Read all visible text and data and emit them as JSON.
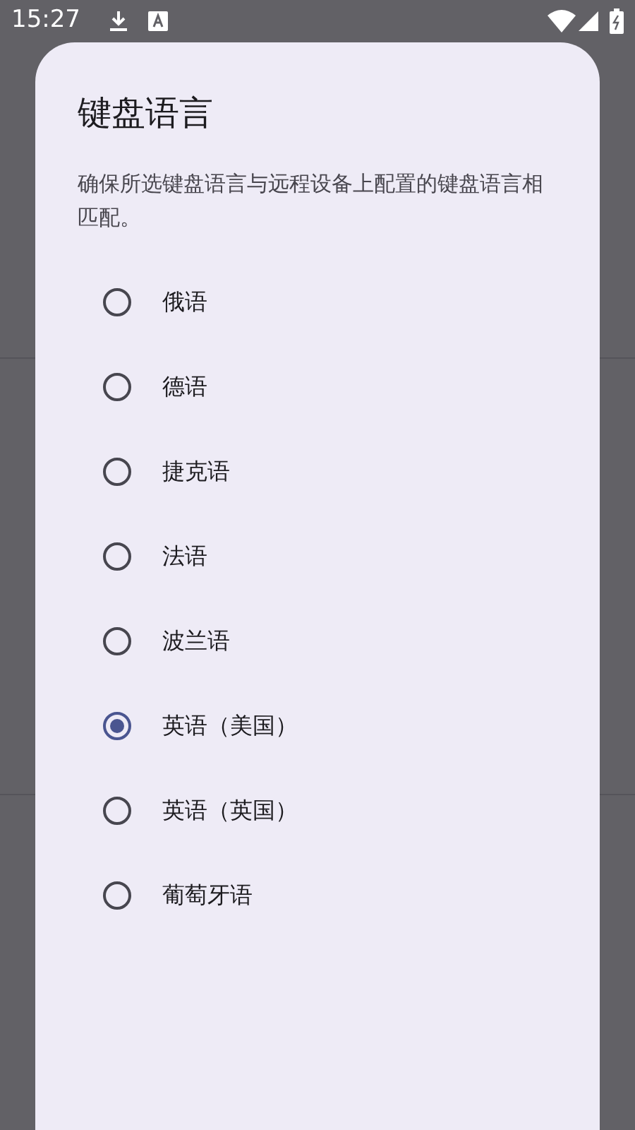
{
  "status_bar": {
    "time": "15:27"
  },
  "dialog": {
    "title": "键盘语言",
    "description": "确保所选键盘语言与远程设备上配置的键盘语言相匹配。",
    "options": [
      {
        "label": "俄语",
        "selected": false
      },
      {
        "label": "德语",
        "selected": false
      },
      {
        "label": "捷克语",
        "selected": false
      },
      {
        "label": "法语",
        "selected": false
      },
      {
        "label": "波兰语",
        "selected": false
      },
      {
        "label": "英语（美国）",
        "selected": true
      },
      {
        "label": "英语（英国）",
        "selected": false
      },
      {
        "label": "葡萄牙语",
        "selected": false
      }
    ]
  }
}
